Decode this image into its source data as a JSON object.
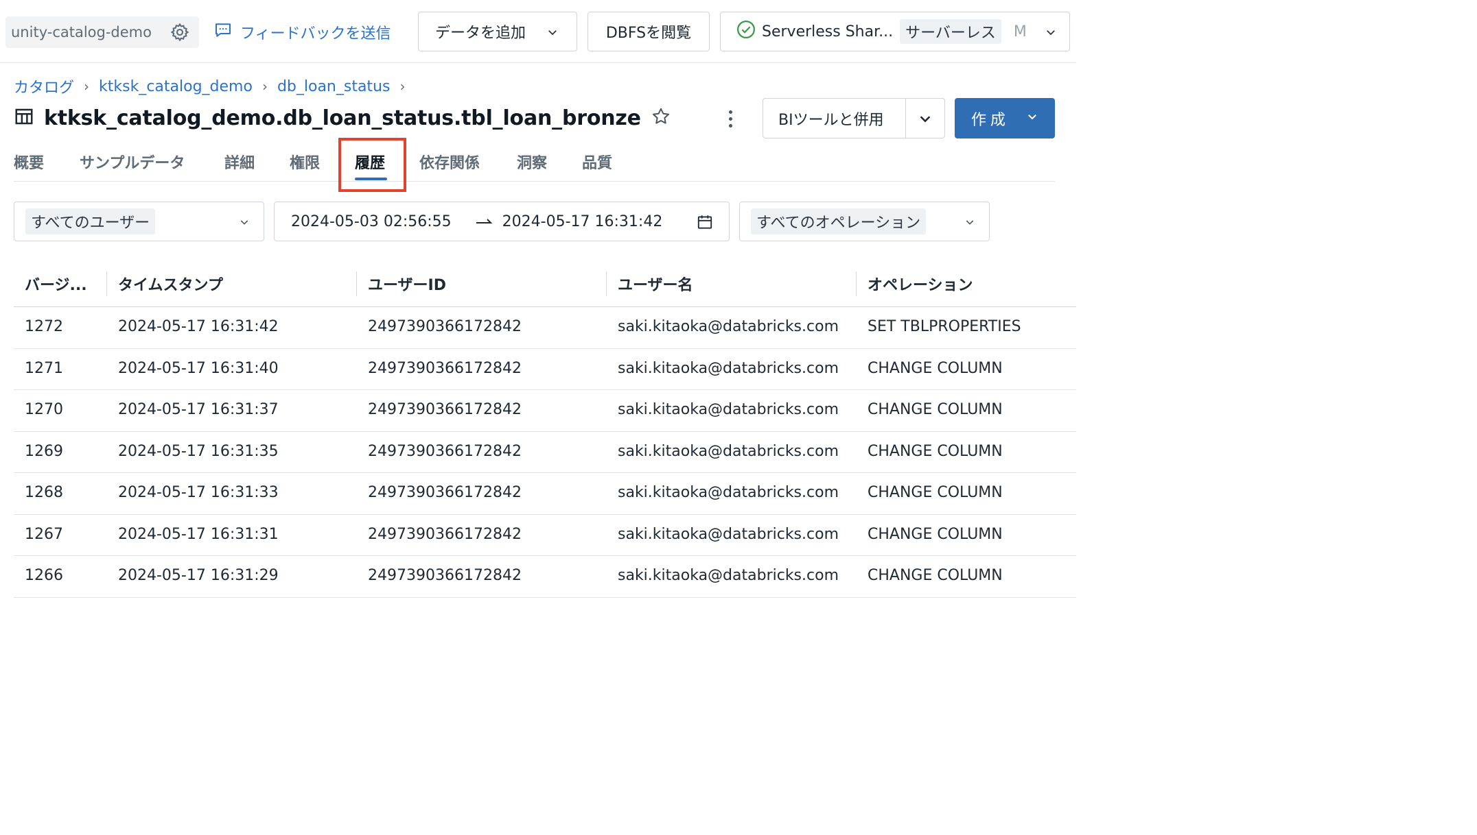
{
  "topbar": {
    "workspace": "unity-catalog-demo",
    "feedback": "フィードバックを送信",
    "add_data": "データを追加",
    "dbfs": "DBFSを閲覧",
    "compute_name": "Serverless Shar...",
    "compute_tag": "サーバーレス",
    "compute_size": "M"
  },
  "breadcrumb": {
    "catalog": "カタログ",
    "catalog_name": "ktksk_catalog_demo",
    "schema": "db_loan_status"
  },
  "title": "ktksk_catalog_demo.db_loan_status.tbl_loan_bronze",
  "actions": {
    "bi": "BIツールと併用",
    "create": "作成"
  },
  "tabs": [
    "概要",
    "サンプルデータ",
    "詳細",
    "権限",
    "履歴",
    "依存関係",
    "洞察",
    "品質"
  ],
  "filters": {
    "users": "すべてのユーザー",
    "date_from": "2024-05-03 02:56:55",
    "date_to": "2024-05-17 16:31:42",
    "operations": "すべてのオペレーション"
  },
  "table": {
    "headers": [
      "バージ...",
      "タイムスタンプ",
      "ユーザーID",
      "ユーザー名",
      "オペレーション"
    ],
    "rows": [
      [
        "1272",
        "2024-05-17 16:31:42",
        "2497390366172842",
        "saki.kitaoka@databricks.com",
        "SET TBLPROPERTIES"
      ],
      [
        "1271",
        "2024-05-17 16:31:40",
        "2497390366172842",
        "saki.kitaoka@databricks.com",
        "CHANGE COLUMN"
      ],
      [
        "1270",
        "2024-05-17 16:31:37",
        "2497390366172842",
        "saki.kitaoka@databricks.com",
        "CHANGE COLUMN"
      ],
      [
        "1269",
        "2024-05-17 16:31:35",
        "2497390366172842",
        "saki.kitaoka@databricks.com",
        "CHANGE COLUMN"
      ],
      [
        "1268",
        "2024-05-17 16:31:33",
        "2497390366172842",
        "saki.kitaoka@databricks.com",
        "CHANGE COLUMN"
      ],
      [
        "1267",
        "2024-05-17 16:31:31",
        "2497390366172842",
        "saki.kitaoka@databricks.com",
        "CHANGE COLUMN"
      ],
      [
        "1266",
        "2024-05-17 16:31:29",
        "2497390366172842",
        "saki.kitaoka@databricks.com",
        "CHANGE COLUMN"
      ]
    ]
  },
  "colors": {
    "accent": "#2f6db5",
    "link": "#2c72c8",
    "highlight": "#e0442e",
    "success": "#3a9a4a"
  }
}
